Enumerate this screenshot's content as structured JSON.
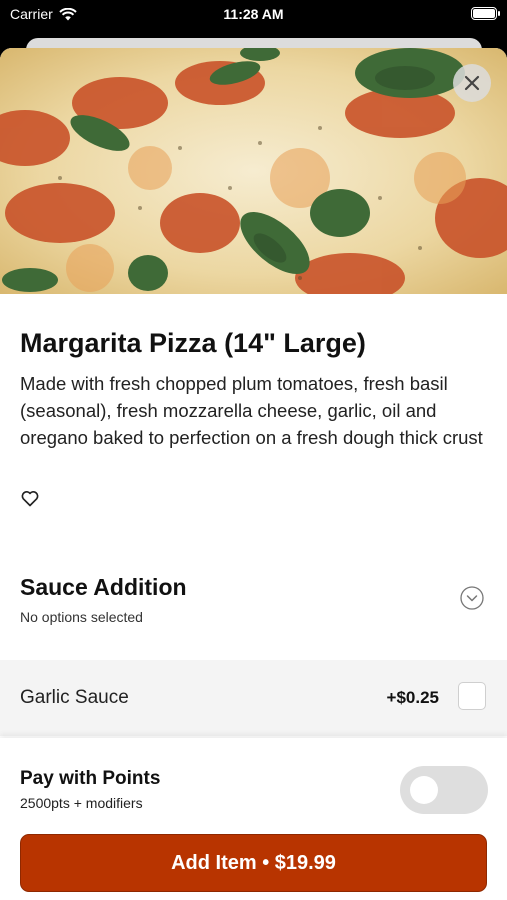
{
  "status_bar": {
    "carrier": "Carrier",
    "time": "11:28 AM"
  },
  "item": {
    "title": "Margarita Pizza (14\" Large)",
    "description": "Made with fresh chopped plum tomatoes, fresh basil (seasonal), fresh mozzarella cheese, garlic, oil and oregano baked to perfection on a fresh dough thick crust"
  },
  "modifier_group": {
    "title": "Sauce Addition",
    "subtitle": "No options selected",
    "options": [
      {
        "label": "Garlic Sauce",
        "price": "+$0.25",
        "checked": false
      }
    ]
  },
  "points": {
    "title": "Pay with Points",
    "subtitle": "2500pts + modifiers",
    "enabled": false
  },
  "add_button": {
    "label": "Add Item • $19.99"
  },
  "colors": {
    "accent": "#b83400"
  }
}
